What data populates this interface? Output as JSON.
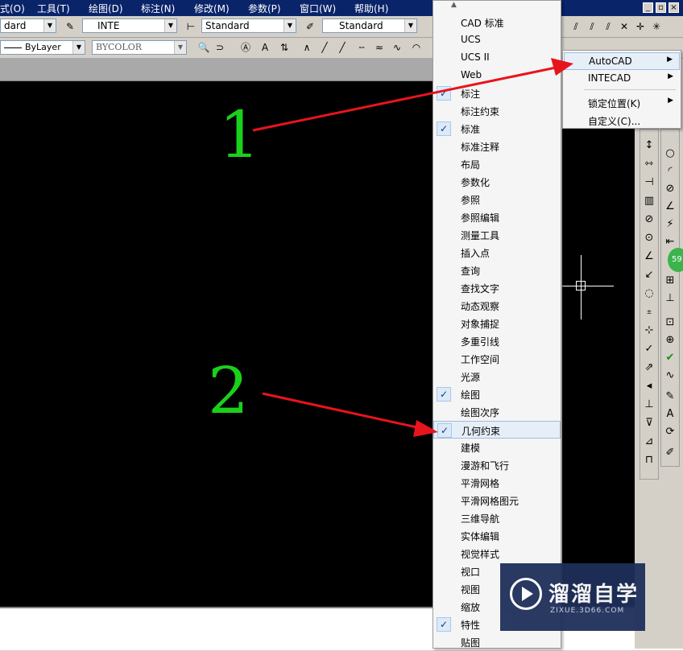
{
  "menubar": {
    "items": [
      "式(O)",
      "工具(T)",
      "绘图(D)",
      "标注(N)",
      "修改(M)",
      "参数(P)",
      "窗口(W)",
      "帮助(H)"
    ],
    "window_buttons": [
      "_",
      "▫",
      "×"
    ]
  },
  "toolbar1": {
    "style_combo": "dard",
    "text_style_combo": "INTE",
    "dim_style_combo": "Standard",
    "table_style_combo": "Standard"
  },
  "toolbar2": {
    "linetype_combo": "ByLayer",
    "color_combo": "BYCOLOR"
  },
  "popup_menu": {
    "items": [
      {
        "label": "CAD 标准",
        "checked": false
      },
      {
        "label": "UCS",
        "checked": false
      },
      {
        "label": "UCS II",
        "checked": false
      },
      {
        "label": "Web",
        "checked": false
      },
      {
        "label": "标注",
        "checked": true
      },
      {
        "label": "标注约束",
        "checked": false
      },
      {
        "label": "标准",
        "checked": true
      },
      {
        "label": "标准注释",
        "checked": false
      },
      {
        "label": "布局",
        "checked": false
      },
      {
        "label": "参数化",
        "checked": false
      },
      {
        "label": "参照",
        "checked": false
      },
      {
        "label": "参照编辑",
        "checked": false
      },
      {
        "label": "测量工具",
        "checked": false
      },
      {
        "label": "插入点",
        "checked": false
      },
      {
        "label": "查询",
        "checked": false
      },
      {
        "label": "查找文字",
        "checked": false
      },
      {
        "label": "动态观察",
        "checked": false
      },
      {
        "label": "对象捕捉",
        "checked": false
      },
      {
        "label": "多重引线",
        "checked": false
      },
      {
        "label": "工作空间",
        "checked": false
      },
      {
        "label": "光源",
        "checked": false
      },
      {
        "label": "绘图",
        "checked": true
      },
      {
        "label": "绘图次序",
        "checked": false
      },
      {
        "label": "几何约束",
        "checked": true
      },
      {
        "label": "建模",
        "checked": false
      },
      {
        "label": "漫游和飞行",
        "checked": false
      },
      {
        "label": "平滑网格",
        "checked": false
      },
      {
        "label": "平滑网格图元",
        "checked": false
      },
      {
        "label": "三维导航",
        "checked": false
      },
      {
        "label": "实体编辑",
        "checked": false
      },
      {
        "label": "视觉样式",
        "checked": false
      },
      {
        "label": "视口",
        "checked": false
      },
      {
        "label": "视图",
        "checked": false
      },
      {
        "label": "缩放",
        "checked": false
      },
      {
        "label": "特性",
        "checked": true
      },
      {
        "label": "贴图",
        "checked": false
      }
    ],
    "highlighted": "几何约束"
  },
  "submenu": {
    "items": [
      {
        "label": "AutoCAD",
        "has_sub": true
      },
      {
        "label": "INTECAD",
        "has_sub": true
      },
      {
        "label": "锁定位置(K)",
        "has_sub": true
      },
      {
        "label": "自定义(C)...",
        "has_sub": false
      }
    ],
    "highlighted": "AutoCAD"
  },
  "annotations": {
    "num1": "1",
    "num2": "2",
    "color": "#e8141c"
  },
  "watermark": {
    "main": "溜溜自学",
    "sub": "ZIXUE.3D66.COM"
  },
  "badge": "59",
  "colors": {
    "menubar_bg": "#0a246a",
    "canvas_bg": "#000000",
    "annotation_green": "#1bd01b",
    "arrow_red": "#e8141c"
  }
}
